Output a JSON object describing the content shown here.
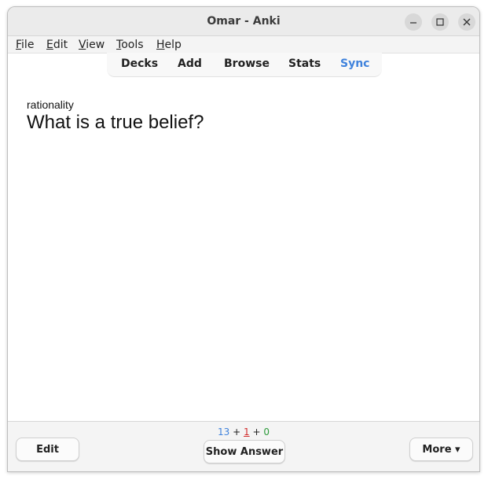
{
  "window": {
    "title": "Omar - Anki"
  },
  "menu": [
    {
      "accel": "F",
      "rest": "ile"
    },
    {
      "accel": "E",
      "rest": "dit"
    },
    {
      "accel": "V",
      "rest": "iew"
    },
    {
      "accel": "T",
      "rest": "ools"
    },
    {
      "accel": "H",
      "rest": "elp"
    }
  ],
  "toolbar": {
    "decks": "Decks",
    "add": "Add",
    "browse": "Browse",
    "stats": "Stats",
    "sync": "Sync"
  },
  "card": {
    "deck": "rationality",
    "question": "What is a true belief?"
  },
  "counts": {
    "new": "13",
    "learn": "1",
    "review": "0",
    "sep": "+"
  },
  "bottom": {
    "edit": "Edit",
    "show_answer": "Show Answer",
    "more": "More ▾"
  },
  "colors": {
    "accent": "#3f82dc",
    "learn": "#d22e2e",
    "review": "#2c9a3a"
  }
}
